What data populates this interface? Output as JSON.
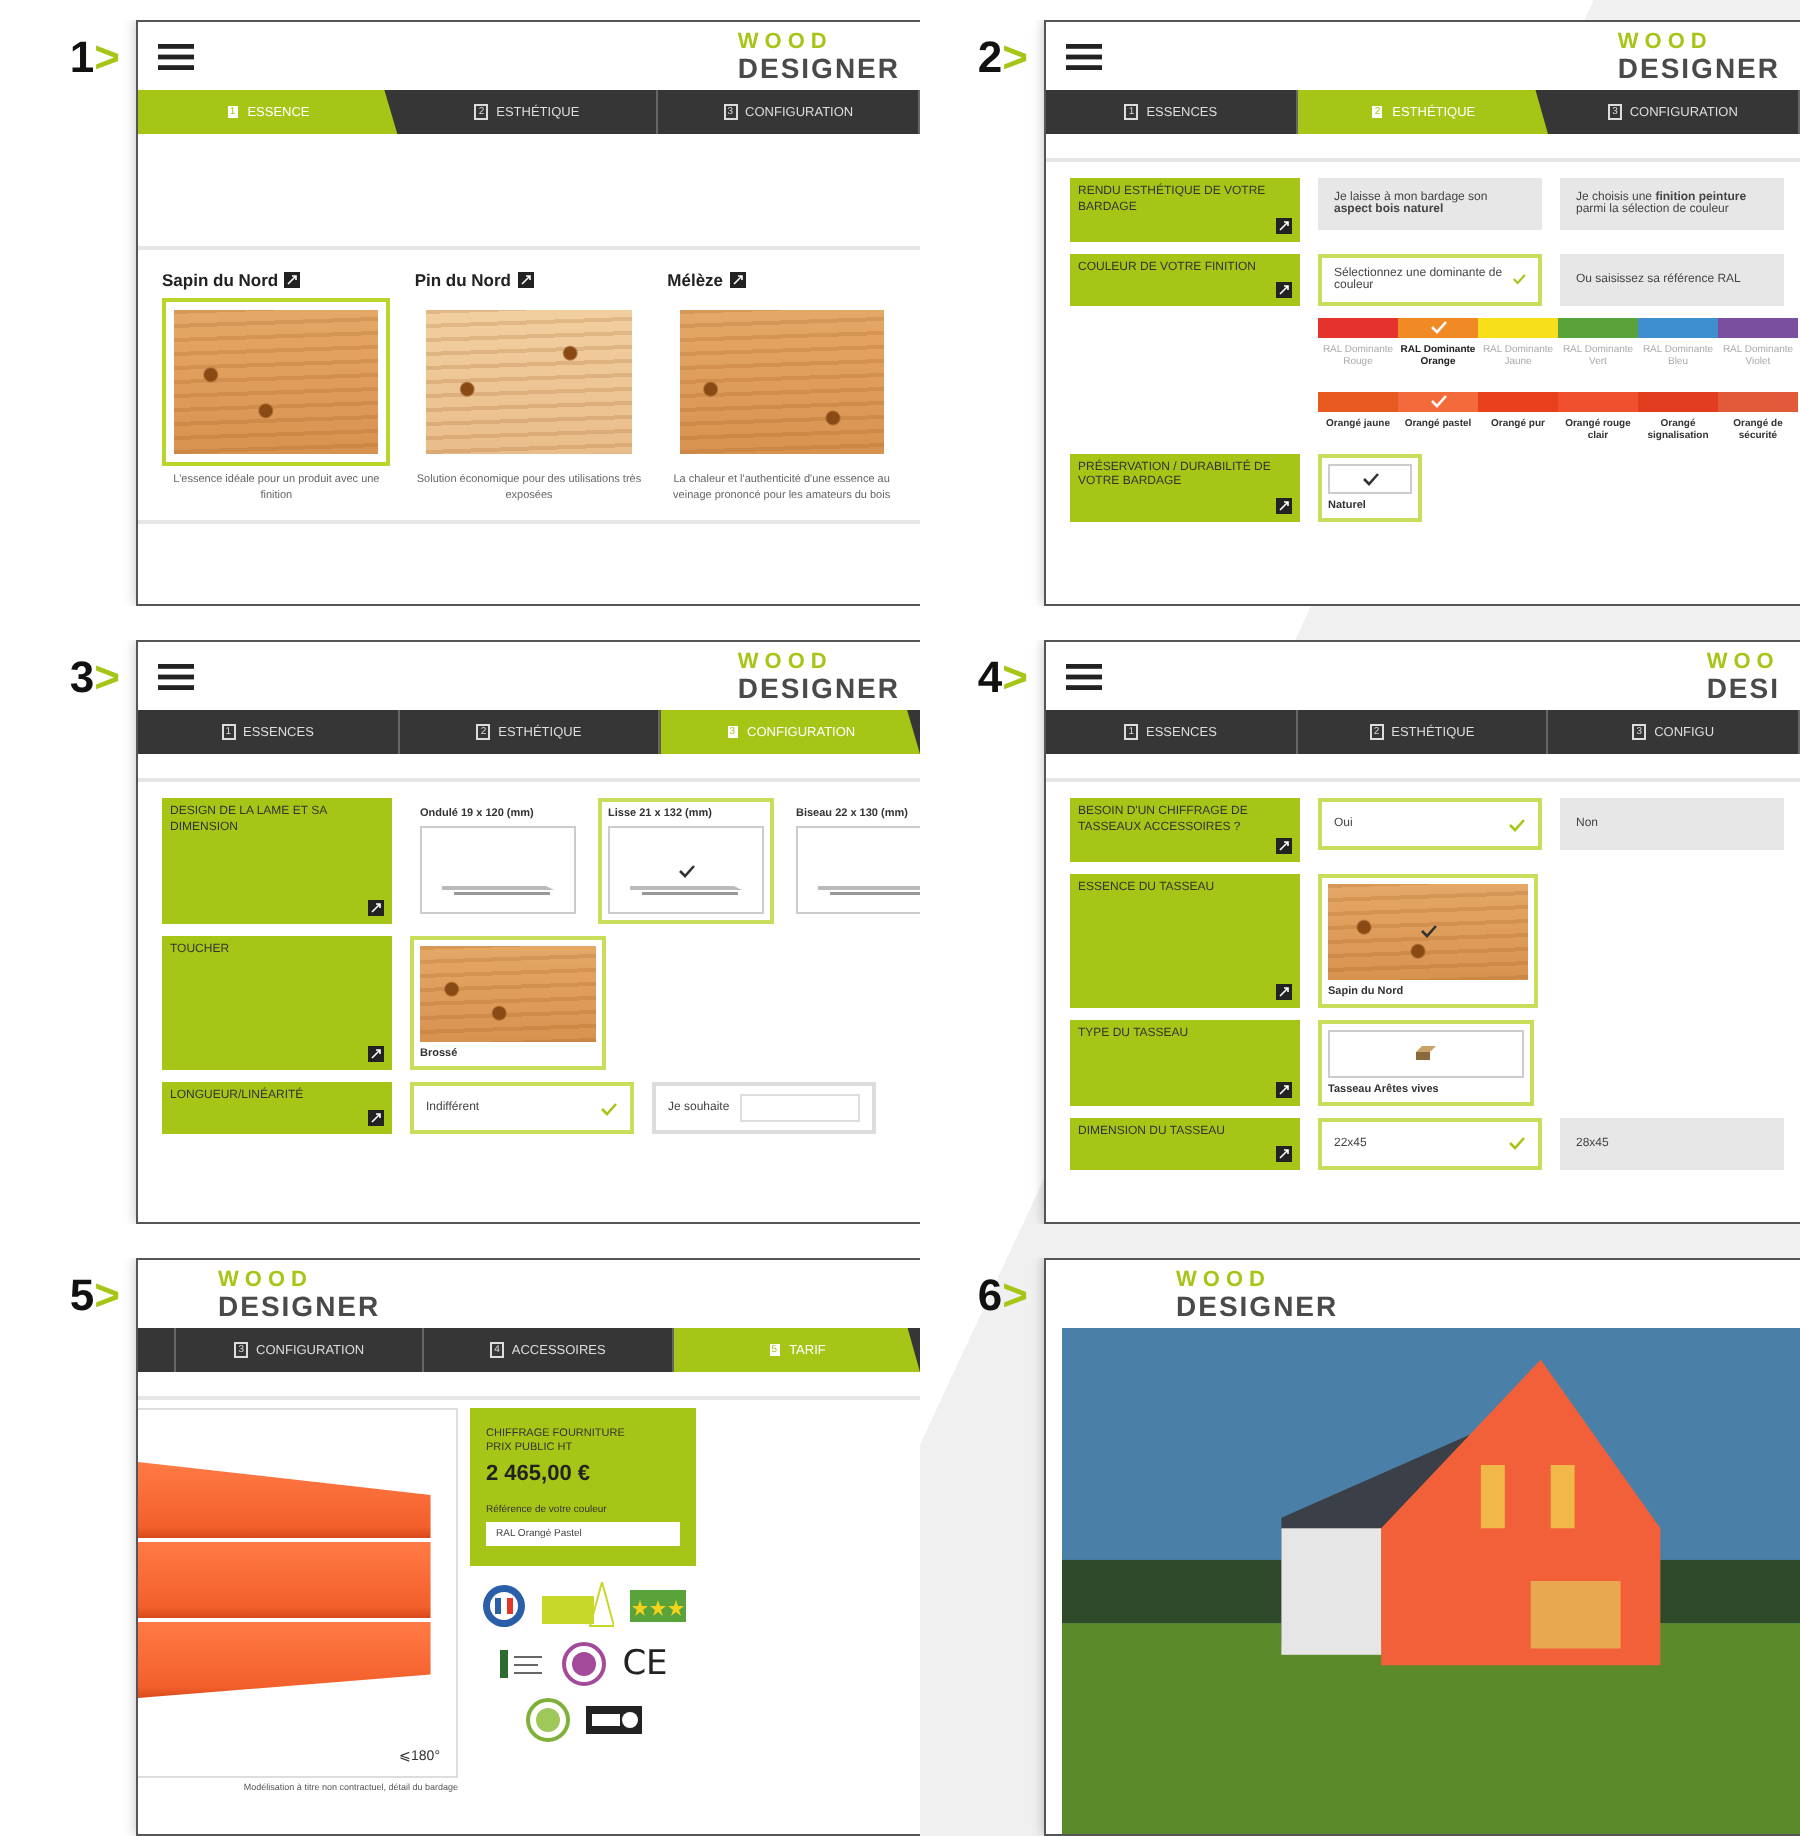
{
  "steps": [
    {
      "number": "1",
      "arrow": ">",
      "screen": {
        "kind": "essences",
        "menu": true,
        "logo": {
          "top": "WOOD",
          "bottom": "DESIGNER"
        },
        "tabs": [
          {
            "number": "1",
            "label": "ESSENCE",
            "selected": true
          },
          {
            "number": "2",
            "label": "ESTHÉTIQUE",
            "selected": false
          },
          {
            "number": "3",
            "label": "CONFIGURATION",
            "selected": false
          }
        ],
        "cards": [
          {
            "title": "Sapin du Nord",
            "description": "L'essence idéale pour un produit avec une finition",
            "selected": true
          },
          {
            "title": "Pin du Nord",
            "description": "Solution économique pour des utilisations très exposées",
            "selected": false
          },
          {
            "title": "Mélèze",
            "description": "La chaleur et l'authenticité d'une essence au veinage prononcé pour les amateurs du bois",
            "selected": false
          }
        ]
      }
    },
    {
      "number": "2",
      "arrow": ">",
      "screen": {
        "kind": "form",
        "menu": true,
        "logo": {
          "top": "WOOD",
          "bottom": "DESIGNER"
        },
        "tabs": [
          {
            "number": "1",
            "label": "ESSENCES",
            "selected": false
          },
          {
            "number": "2",
            "label": "ESTHÉTIQUE",
            "selected": true
          },
          {
            "number": "3",
            "label": "CONFIGURATION",
            "selected": false
          }
        ],
        "rows": [
          {
            "kind": "choice",
            "label": "RENDU ESTHÉTIQUE DE VOTRE BARDAGE",
            "options": [
              {
                "text": "Je laisse à mon bardage son **aspect bois naturel**",
                "selected": false
              },
              {
                "text": "Je choisis une **finition peinture** parmi la sélection de couleur",
                "selected": false
              }
            ]
          },
          {
            "kind": "choice",
            "label": "COULEUR DE VOTRE FINITION",
            "options": [
              {
                "text": "Sélectionnez une dominante de couleur",
                "selected": true
              },
              {
                "text": "Ou saisissez sa référence RAL",
                "selected": false
              }
            ]
          },
          {
            "kind": "palette",
            "hues": [
              {
                "label": "RAL Dominante Rouge",
                "color": "#e5322d",
                "selected": false
              },
              {
                "label": "RAL Dominante Orange",
                "color": "#f08a24",
                "selected": true
              },
              {
                "label": "RAL Dominante Jaune",
                "color": "#f7e01a",
                "selected": false
              },
              {
                "label": "RAL Dominante Vert",
                "color": "#5aa33a",
                "selected": false
              },
              {
                "label": "RAL Dominante Bleu",
                "color": "#3d8fd0",
                "selected": false
              },
              {
                "label": "RAL Dominante Violet",
                "color": "#7b4fa0",
                "selected": false
              }
            ],
            "shades": [
              {
                "label": "Orangé jaune",
                "color": "#e8591f",
                "selected": false
              },
              {
                "label": "Orangé pastel",
                "color": "#f56a3a",
                "selected": true
              },
              {
                "label": "Orangé pur",
                "color": "#e8401c",
                "selected": false
              },
              {
                "label": "Orangé rouge clair",
                "color": "#f0502e",
                "selected": false
              },
              {
                "label": "Orangé signalisation",
                "color": "#e23d1f",
                "selected": false
              },
              {
                "label": "Orangé de sécurité",
                "color": "#e35a3a",
                "selected": false
              }
            ]
          },
          {
            "kind": "tiles",
            "label": "PRÉSERVATION / DURABILITÉ DE VOTRE BARDAGE",
            "tiles": [
              {
                "kind": "check",
                "text": "Naturel",
                "selected": true
              }
            ]
          }
        ]
      }
    },
    {
      "number": "3",
      "arrow": ">",
      "screen": {
        "kind": "form",
        "menu": true,
        "logo": {
          "top": "WOOD",
          "bottom": "DESIGNER"
        },
        "tabs": [
          {
            "number": "1",
            "label": "ESSENCES",
            "selected": false
          },
          {
            "number": "2",
            "label": "ESTHÉTIQUE",
            "selected": false
          },
          {
            "number": "3",
            "label": "CONFIGURATION",
            "selected": true
          }
        ],
        "rows": [
          {
            "kind": "tiles",
            "label": "DESIGN DE LA LAME ET SA DIMENSION",
            "tiles": [
              {
                "kind": "profile",
                "text": "Ondulé 19 x 120 (mm)",
                "selected": false
              },
              {
                "kind": "profile",
                "text": "Lisse 21 x 132 (mm)",
                "selected": true
              },
              {
                "kind": "profile",
                "text": "Biseau 22 x 130 (mm)",
                "selected": false
              }
            ]
          },
          {
            "kind": "tiles",
            "label": "TOUCHER",
            "tiles": [
              {
                "kind": "wood",
                "text": "Brossé",
                "selected": true
              }
            ]
          },
          {
            "kind": "choice",
            "label": "LONGUEUR/LINÉARITÉ",
            "options": [
              {
                "kind": "plain",
                "text": "Indifférent",
                "selected": true
              },
              {
                "kind": "field",
                "text": "Je souhaite",
                "selected": false
              }
            ]
          }
        ]
      }
    },
    {
      "number": "4",
      "arrow": ">",
      "screen": {
        "kind": "form",
        "menu": true,
        "logo": {
          "top": "WOO",
          "bottom": "DESI"
        },
        "tabs": [
          {
            "number": "1",
            "label": "ESSENCES",
            "selected": false
          },
          {
            "number": "2",
            "label": "ESTHÉTIQUE",
            "selected": false
          },
          {
            "number": "3",
            "label": "CONFIGU",
            "selected": false
          }
        ],
        "rows": [
          {
            "kind": "choice",
            "label": "BESOIN D'UN CHIFFRAGE DE TASSEAUX ACCESSOIRES ?",
            "options": [
              {
                "text": "Oui",
                "selected": true
              },
              {
                "text": "Non",
                "selected": false
              }
            ]
          },
          {
            "kind": "tiles",
            "label": "ESSENCE DU TASSEAU",
            "tiles": [
              {
                "kind": "wood",
                "text": "Sapin du Nord",
                "selected": true
              }
            ]
          },
          {
            "kind": "tiles",
            "label": "TYPE DU TASSEAU",
            "tiles": [
              {
                "kind": "batten",
                "text": "Tasseau Arêtes vives",
                "selected": true
              }
            ]
          },
          {
            "kind": "choice",
            "label": "DIMENSION DU TASSEAU",
            "options": [
              {
                "text": "22x45",
                "selected": true
              },
              {
                "text": "28x45",
                "selected": false
              }
            ]
          }
        ]
      }
    },
    {
      "number": "5",
      "arrow": ">",
      "screen": {
        "kind": "tarif",
        "logo": {
          "top": "WOOD",
          "bottom": "DESIGNER"
        },
        "tabs": [
          {
            "number": "3",
            "label": "CONFIGURATION",
            "selected": false
          },
          {
            "number": "4",
            "label": "ACCESSOIRES",
            "selected": false
          },
          {
            "number": "5",
            "label": "TARIF",
            "selected": true
          }
        ],
        "visual": {
          "angle": "⩽180°",
          "caption": "Modélisation à titre non contractuel, détail du bardage"
        },
        "panel": {
          "title": "CHIFFRAGE FOURNITURE PRIX PUBLIC HT",
          "price": "2 465,00 €",
          "field_label": "Référence de votre couleur",
          "field_value": "RAL Orangé Pastel"
        },
        "badges": [
          {
            "kind": "flag-seal"
          },
          {
            "kind": "tree-label"
          },
          {
            "kind": "stars-label"
          },
          {
            "kind": "figure-label"
          },
          {
            "kind": "ring-seal"
          },
          {
            "kind": "ce",
            "text": "CE"
          },
          {
            "kind": "leaf-seal"
          },
          {
            "kind": "striped-label"
          }
        ]
      }
    },
    {
      "number": "6",
      "arrow": ">",
      "screen": {
        "kind": "photo",
        "logo": {
          "top": "WOOD",
          "bottom": "DESIGNER"
        }
      }
    }
  ]
}
